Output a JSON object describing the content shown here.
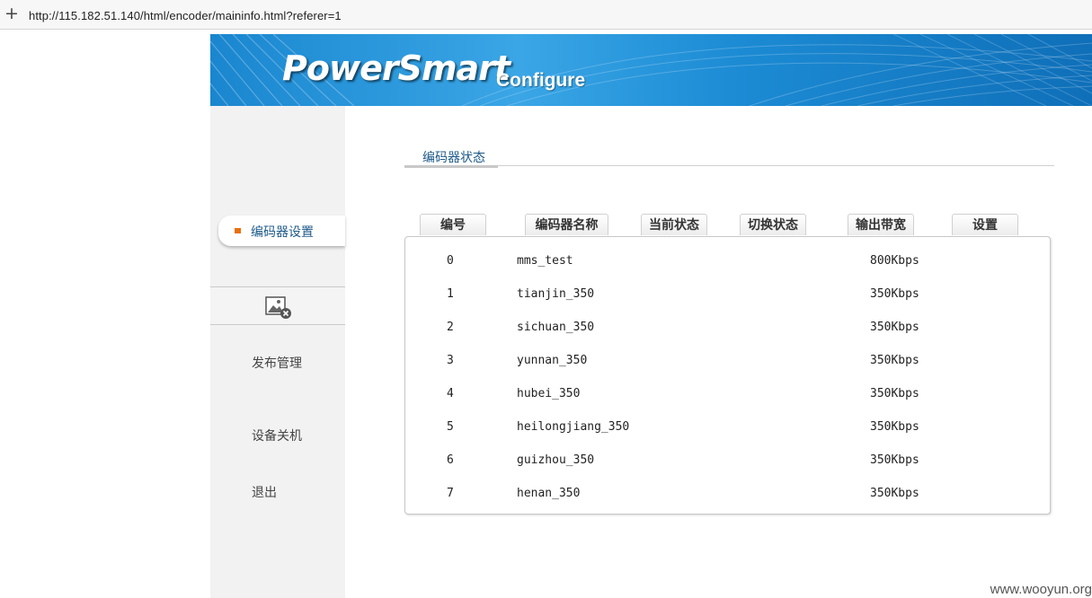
{
  "browser": {
    "plus_label": "+",
    "url": "http://115.182.51.140/html/encoder/maininfo.html?referer=1"
  },
  "banner": {
    "logo": "PowerSmart",
    "subtitle": "Configure"
  },
  "sidebar": {
    "active_item": "编码器设置",
    "items": [
      {
        "label": "发布管理"
      },
      {
        "label": "设备关机"
      },
      {
        "label": "退出"
      }
    ],
    "accent_color": "#e8700e"
  },
  "tabs": [
    {
      "label": "编码器状态",
      "active": true
    }
  ],
  "table": {
    "columns": [
      "编号",
      "编码器名称",
      "当前状态",
      "切换状态",
      "输出带宽",
      "设置"
    ],
    "rows": [
      {
        "id": "0",
        "name": "mms_test",
        "bandwidth": "800Kbps"
      },
      {
        "id": "1",
        "name": "tianjin_350",
        "bandwidth": "350Kbps"
      },
      {
        "id": "2",
        "name": "sichuan_350",
        "bandwidth": "350Kbps"
      },
      {
        "id": "3",
        "name": "yunnan_350",
        "bandwidth": "350Kbps"
      },
      {
        "id": "4",
        "name": "hubei_350",
        "bandwidth": "350Kbps"
      },
      {
        "id": "5",
        "name": "heilongjiang_350",
        "bandwidth": "350Kbps"
      },
      {
        "id": "6",
        "name": "guizhou_350",
        "bandwidth": "350Kbps"
      },
      {
        "id": "7",
        "name": "henan_350",
        "bandwidth": "350Kbps"
      }
    ]
  },
  "watermark": "www.wooyun.org"
}
